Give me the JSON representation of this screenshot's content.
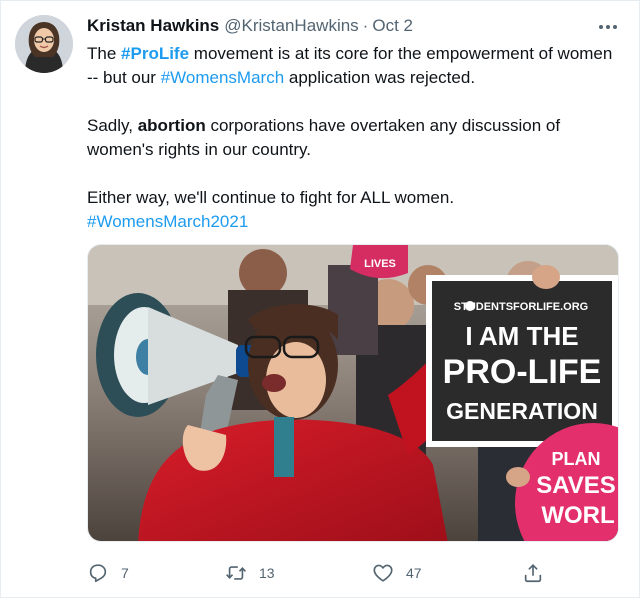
{
  "author": {
    "name": "Kristan Hawkins",
    "handle": "@KristanHawkins",
    "separator": "·",
    "date": "Oct 2"
  },
  "tweet": {
    "p1": {
      "t1": "The ",
      "h1": "#ProLife",
      "t2": " movement is at its core for the empowerment of women -- but our ",
      "h2": "#WomensMarch",
      "t3": " application was rejected."
    },
    "p2": {
      "t1": "Sadly, ",
      "b1": "abortion",
      "t2": " corporations have overtaken any discussion of women's rights in our country."
    },
    "p3": {
      "t1": "Either way, we'll continue to fight for ALL women.",
      "h1": "#WomensMarch2021"
    }
  },
  "media": {
    "sign_org": "STUDENTSFORLIFE.ORG",
    "sign_line1": "I AM THE",
    "sign_line2": "PRO-LIFE",
    "sign_line3": "GENERATION",
    "pink_sign_line1": "PLAN",
    "pink_sign_line2": "SAVES",
    "pink_sign_line3": "WORL",
    "top_sign_text": "LIVES"
  },
  "stats": {
    "replies": "7",
    "retweets": "13",
    "likes": "47"
  },
  "colors": {
    "link": "#1d9bf0",
    "muted": "#536471",
    "coat": "#c0121f",
    "sign_bg": "#2b2b2b",
    "pink_sign": "#e3306c"
  },
  "icons": {
    "more": "more-icon",
    "reply": "reply-icon",
    "retweet": "retweet-icon",
    "like": "heart-icon",
    "share": "share-icon"
  }
}
